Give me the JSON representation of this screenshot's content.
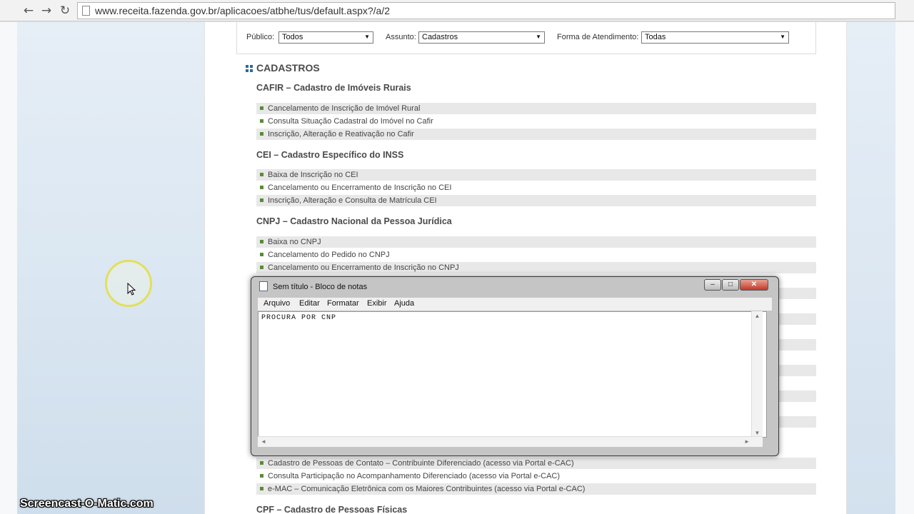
{
  "browser": {
    "back_icon": "←",
    "forward_icon": "→",
    "reload_icon": "↻",
    "url": "www.receita.fazenda.gov.br/aplicacoes/atbhe/tus/default.aspx?/a/2"
  },
  "filters": {
    "publico_label": "Público:",
    "publico_value": "Todos",
    "assunto_label": "Assunto:",
    "assunto_value": "Cadastros",
    "forma_label": "Forma de Atendimento:",
    "forma_value": "Todas",
    "arrow": "▼"
  },
  "section": {
    "title": "CADASTROS",
    "categories": [
      {
        "title": "CAFIR – Cadastro de Imóveis Rurais",
        "items": [
          "Cancelamento de Inscrição de Imóvel Rural",
          "Consulta Situação Cadastral do Imóvel no Cafir",
          "Inscrição, Alteração e Reativação no Cafir"
        ]
      },
      {
        "title": "CEI – Cadastro Específico do INSS",
        "items": [
          "Baixa de Inscrição no CEI",
          "Cancelamento ou Encerramento de Inscrição no CEI",
          "Inscrição, Alteração e Consulta de Matrícula CEI"
        ]
      },
      {
        "title": "CNPJ – Cadastro Nacional da Pessoa Jurídica",
        "items": [
          "Baixa no CNPJ",
          "Cancelamento do Pedido no CNPJ",
          "Cancelamento ou Encerramento de Inscrição no CNPJ"
        ]
      }
    ],
    "lower_items": [
      "Cadastro de Pessoas de Contato – Contribuinte Diferenciado (acesso via Portal e-CAC)",
      "Consulta Participação no Acompanhamento Diferenciado (acesso via Portal e-CAC)",
      "e-MAC – Comunicação Eletrônica com os Maiores Contribuintes (acesso via Portal e-CAC)"
    ],
    "next_category": "CPF – Cadastro de Pessoas Físicas"
  },
  "notepad": {
    "title": "Sem título - Bloco de notas",
    "minimize": "–",
    "maximize": "□",
    "close": "✕",
    "menu": [
      "Arquivo",
      "Editar",
      "Formatar",
      "Exibir",
      "Ajuda"
    ],
    "text": "PROCURA POR CNP",
    "scroll_up": "▲",
    "scroll_down": "▼",
    "scroll_left": "◄",
    "scroll_right": "►"
  },
  "watermark": "Screencast-O-Matic.com"
}
